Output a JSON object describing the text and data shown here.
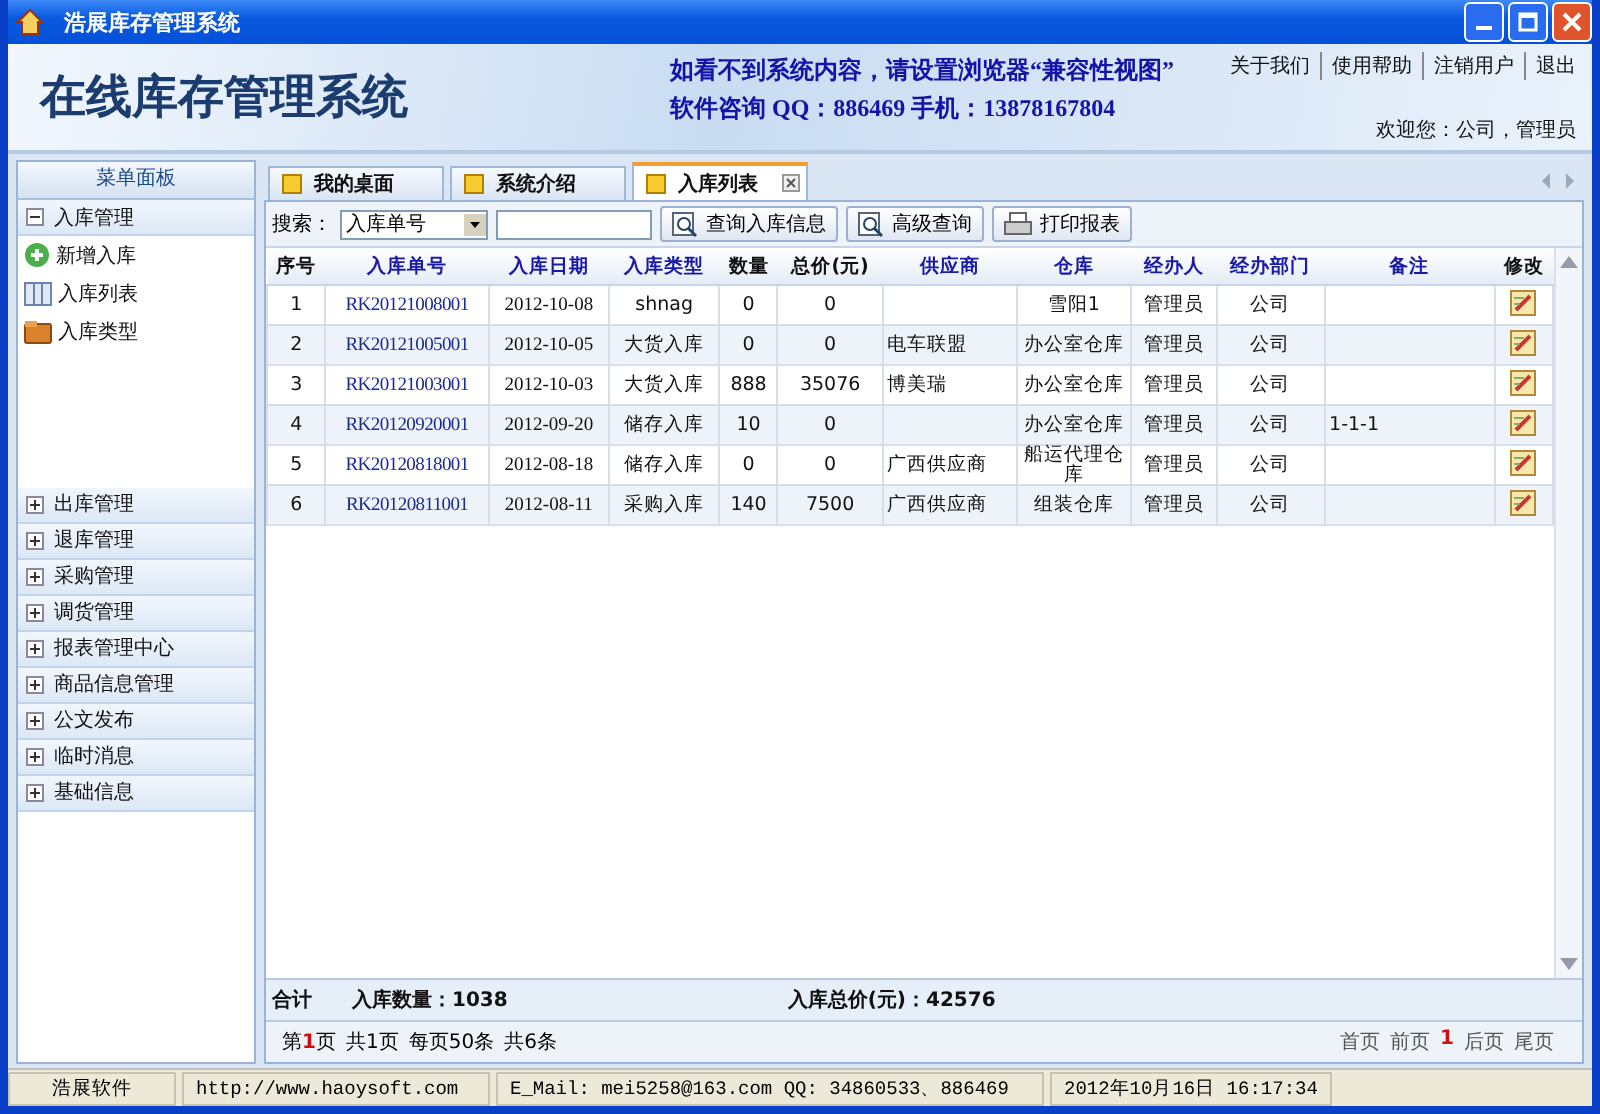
{
  "window": {
    "title": "浩展库存管理系统"
  },
  "header": {
    "logo": "在线库存管理系统",
    "notice": "如看不到系统内容，请设置浏览器“兼容性视图”",
    "contact": "软件咨询 QQ：886469 手机：13878167804",
    "links": [
      "关于我们",
      "使用帮助",
      "注销用户",
      "退出"
    ],
    "welcome": "欢迎您：公司，管理员"
  },
  "sidebar": {
    "title": "菜单面板",
    "groups": [
      {
        "label": "入库管理",
        "expanded": true,
        "children": [
          {
            "label": "新增入库",
            "kind": "add"
          },
          {
            "label": "入库列表",
            "kind": "list"
          },
          {
            "label": "入库类型",
            "kind": "folder"
          }
        ]
      },
      {
        "label": "出库管理",
        "expanded": false
      },
      {
        "label": "退库管理",
        "expanded": false
      },
      {
        "label": "采购管理",
        "expanded": false
      },
      {
        "label": "调货管理",
        "expanded": false
      },
      {
        "label": "报表管理中心",
        "expanded": false
      },
      {
        "label": "商品信息管理",
        "expanded": false
      },
      {
        "label": "公文发布",
        "expanded": false
      },
      {
        "label": "临时消息",
        "expanded": false
      },
      {
        "label": "基础信息",
        "expanded": false
      }
    ]
  },
  "tabs": [
    {
      "label": "我的桌面",
      "selected": false,
      "closable": false
    },
    {
      "label": "系统介绍",
      "selected": false,
      "closable": false
    },
    {
      "label": "入库列表",
      "selected": true,
      "closable": true
    }
  ],
  "toolbar": {
    "search_label": "搜索：",
    "search_field": "入库单号",
    "buttons": [
      {
        "label": "查询入库信息",
        "kind": "search"
      },
      {
        "label": "高级查询",
        "kind": "search"
      },
      {
        "label": "打印报表",
        "kind": "print"
      }
    ]
  },
  "table": {
    "columns": [
      "序号",
      "入库单号",
      "入库日期",
      "入库类型",
      "数量",
      "总价(元)",
      "供应商",
      "仓库",
      "经办人",
      "经办部门",
      "备注",
      "修改"
    ],
    "rows": [
      [
        "1",
        "RK20121008001",
        "2012-10-08",
        "shnag",
        "0",
        "0",
        "",
        "雪阳1",
        "管理员",
        "公司",
        ""
      ],
      [
        "2",
        "RK20121005001",
        "2012-10-05",
        "大货入库",
        "0",
        "0",
        "电车联盟",
        "办公室仓库",
        "管理员",
        "公司",
        ""
      ],
      [
        "3",
        "RK20121003001",
        "2012-10-03",
        "大货入库",
        "888",
        "35076",
        "博美瑞",
        "办公室仓库",
        "管理员",
        "公司",
        ""
      ],
      [
        "4",
        "RK20120920001",
        "2012-09-20",
        "储存入库",
        "10",
        "0",
        "",
        "办公室仓库",
        "管理员",
        "公司",
        "1-1-1"
      ],
      [
        "5",
        "RK20120818001",
        "2012-08-18",
        "储存入库",
        "0",
        "0",
        "广西供应商",
        "船运代理仓库",
        "管理员",
        "公司",
        ""
      ],
      [
        "6",
        "RK20120811001",
        "2012-08-11",
        "采购入库",
        "140",
        "7500",
        "广西供应商",
        "组装仓库",
        "管理员",
        "公司",
        ""
      ]
    ]
  },
  "summary": {
    "label": "合计",
    "quantity": "入库数量：1038",
    "total": "入库总价(元)：42576"
  },
  "pager": {
    "prefix": "第",
    "current": "1",
    "suffix": "页",
    "total_pages": "共1页",
    "per_page": "每页50条",
    "total": "共6条",
    "nav": [
      "首页",
      "前页",
      "1",
      "后页",
      "尾页"
    ]
  },
  "status_bar": [
    "浩展软件",
    "http://www.haoysoft.com",
    "E_Mail: mei5258@163.com  QQ: 34860533、886469",
    "2012年10月16日 16:17:34"
  ]
}
